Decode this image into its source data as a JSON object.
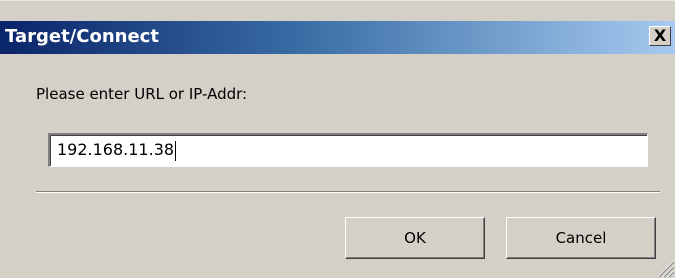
{
  "dialog": {
    "title": "Target/Connect",
    "close_label": "X",
    "prompt": "Please enter URL or IP-Addr:",
    "input_value": "192.168.11.38",
    "ok_label": "OK",
    "cancel_label": "Cancel"
  },
  "icons": {
    "close": "close-icon",
    "resize_grip": "resize-grip-icon"
  },
  "colors": {
    "titlebar_start": "#0a246a",
    "titlebar_end": "#a6caf0",
    "dialog_background": "#d4d0c8"
  }
}
